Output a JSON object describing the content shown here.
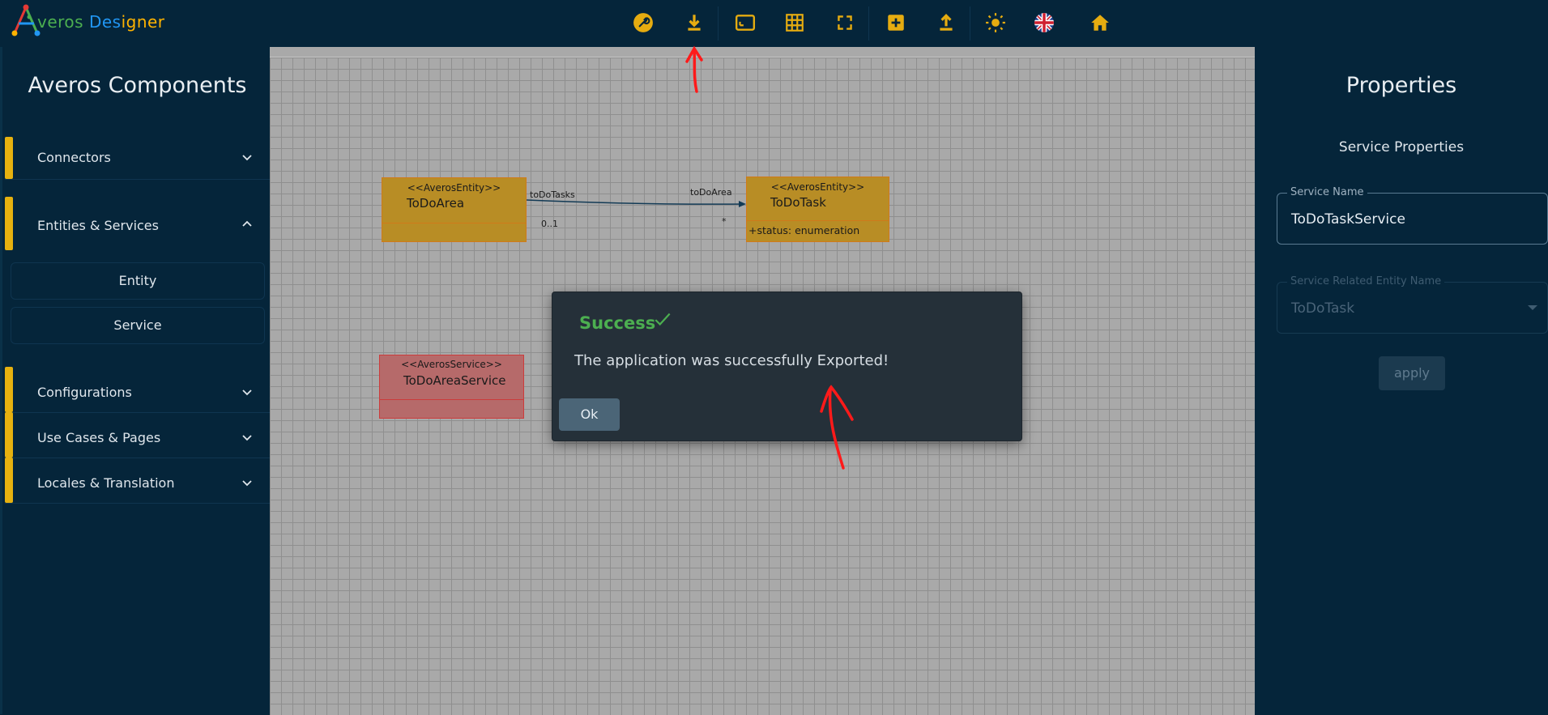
{
  "app": {
    "logo_text_parts": [
      "A",
      "veros",
      "Des",
      "igner"
    ]
  },
  "toolbar": {
    "tools": [
      {
        "icon": "wrench-icon"
      },
      {
        "icon": "download-icon"
      },
      {
        "icon": "fit-screen-icon"
      },
      {
        "icon": "grid-icon"
      },
      {
        "icon": "fullscreen-icon"
      },
      {
        "icon": "add-box-icon"
      },
      {
        "icon": "upload-icon"
      },
      {
        "icon": "brightness-icon"
      },
      {
        "icon": "uk-flag-icon"
      },
      {
        "icon": "home-icon"
      }
    ],
    "accent_color": "#e6ac10"
  },
  "left_panel": {
    "title": "Averos Components",
    "sections": [
      {
        "label": "Connectors",
        "expanded": false
      },
      {
        "label": "Entities & Services",
        "expanded": true,
        "items": [
          "Entity",
          "Service"
        ]
      },
      {
        "label": "Configurations",
        "expanded": false
      },
      {
        "label": "Use Cases & Pages",
        "expanded": false
      },
      {
        "label": "Locales & Translation",
        "expanded": false
      }
    ]
  },
  "canvas": {
    "entities": [
      {
        "stereotype": "<<AverosEntity>>",
        "name": "ToDoArea",
        "attributes": []
      },
      {
        "stereotype": "<<AverosEntity>>",
        "name": "ToDoTask",
        "attributes": [
          "+status: enumeration"
        ]
      },
      {
        "stereotype": "<<AverosService>>",
        "name": "ToDoAreaService",
        "attributes": []
      }
    ],
    "association": {
      "source_role": "toDoTasks",
      "target_role": "toDoArea",
      "source_multiplicity": "0..1",
      "target_multiplicity": "*"
    }
  },
  "right_panel": {
    "title": "Properties",
    "subtitle": "Service Properties",
    "service_name_label": "Service Name",
    "service_name_value": "ToDoTaskService",
    "related_entity_label": "Service Related Entity Name",
    "related_entity_value": "ToDoTask",
    "apply_label": "apply"
  },
  "dialog": {
    "title": "Success",
    "message": "The application was successfully Exported!",
    "ok_label": "Ok",
    "title_color": "#4caf50"
  }
}
